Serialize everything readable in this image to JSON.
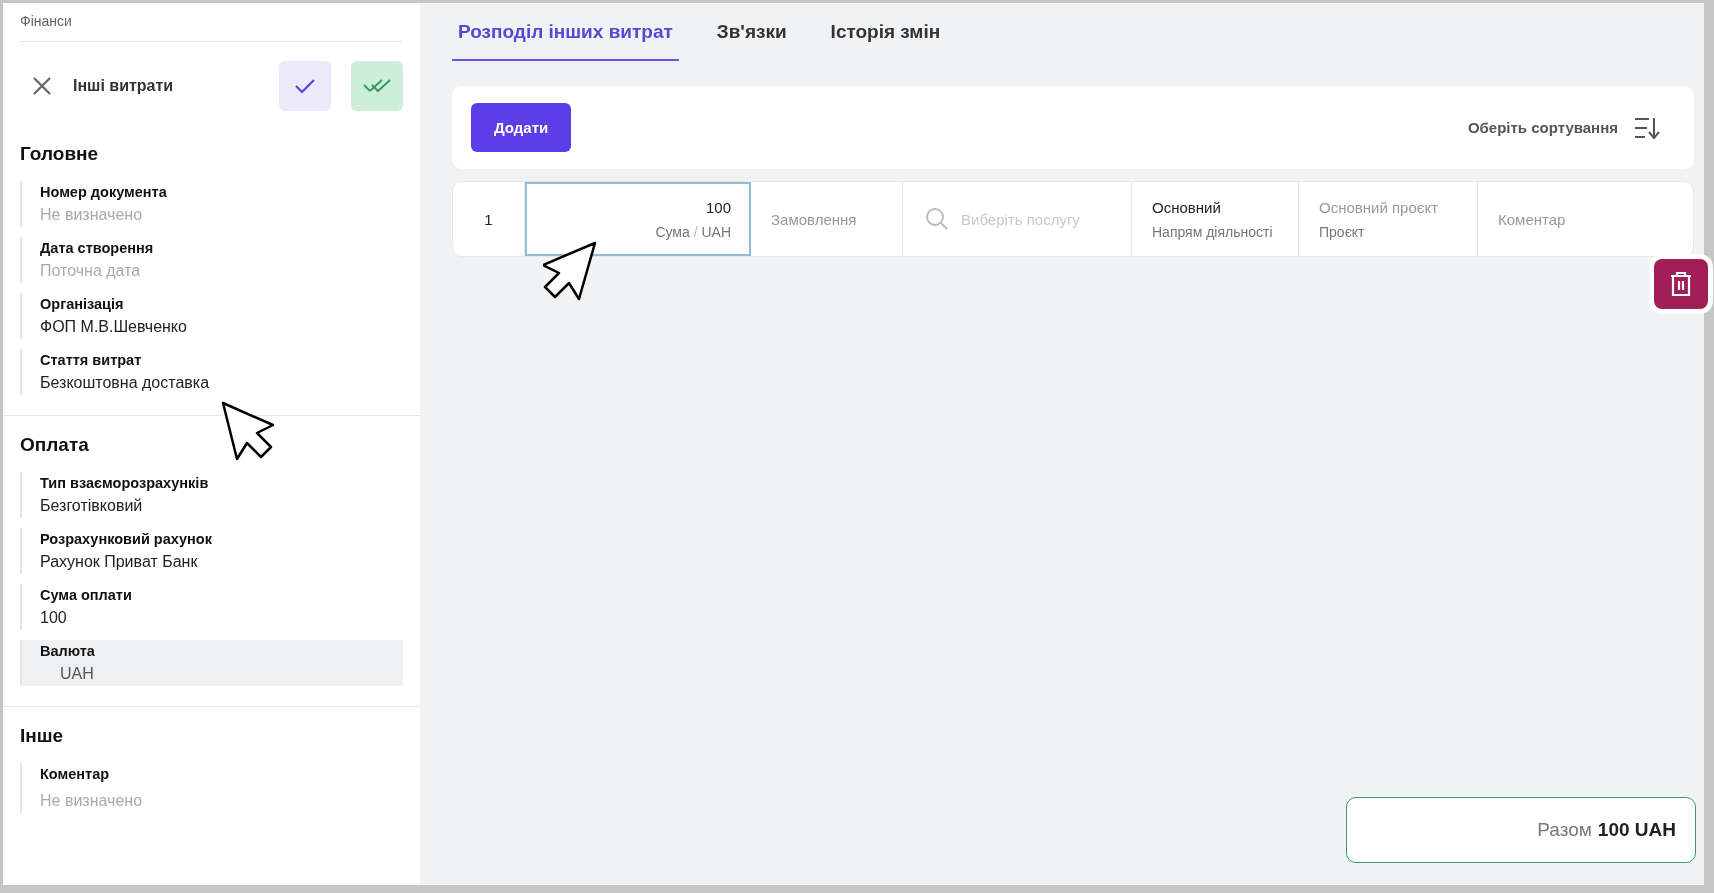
{
  "breadcrumb": "Фінанси",
  "header": {
    "title": "Інші витрати"
  },
  "sections": [
    {
      "title": "Головне",
      "fields": [
        {
          "label": "Номер документа",
          "placeholder": "Не визначено",
          "disabled": false
        },
        {
          "label": "Дата створення",
          "placeholder": "Поточна дата",
          "disabled": false
        },
        {
          "label": "Організація",
          "value": "ФОП М.В.Шевченко",
          "disabled": false
        },
        {
          "label": "Стаття витрат",
          "value": "Безкоштовна доставка",
          "disabled": false
        }
      ]
    },
    {
      "title": "Оплата",
      "fields": [
        {
          "label": "Тип взаєморозрахунків",
          "value": "Безготівковий",
          "disabled": false
        },
        {
          "label": "Розрахунковий рахунок",
          "value": "Рахунок Приват Банк",
          "disabled": false
        },
        {
          "label": "Сума оплати",
          "value": "100",
          "disabled": false
        },
        {
          "label": "Валюта",
          "value": "UAH",
          "disabled": true
        }
      ]
    },
    {
      "title": "Інше",
      "fields": [
        {
          "label": "Коментар",
          "placeholder": "Не визначено",
          "disabled": false
        }
      ]
    }
  ],
  "tabs": [
    {
      "label": "Розподіл інших витрат",
      "selected": true
    },
    {
      "label": "Зв'язки",
      "selected": false
    },
    {
      "label": "Історія змін",
      "selected": false
    }
  ],
  "toolbar": {
    "add_button": "Додати",
    "sort": "Оберіть сортування"
  },
  "row": {
    "index": "1",
    "amount": {
      "value": "100",
      "label": "Сума",
      "separator": "/",
      "currency": "UAH",
      "focused": true
    },
    "order": {
      "placeholder": "Замовлення"
    },
    "service": {
      "placeholder": "Виберіть послугу"
    },
    "direction": {
      "value": "Основний",
      "label": "Напрям діяльності"
    },
    "project": {
      "placeholder": "Основний проєкт",
      "label": "Проєкт"
    },
    "comment": {
      "placeholder": "Коментар"
    }
  },
  "total": {
    "label": "Разом",
    "value": "100 UAH"
  }
}
